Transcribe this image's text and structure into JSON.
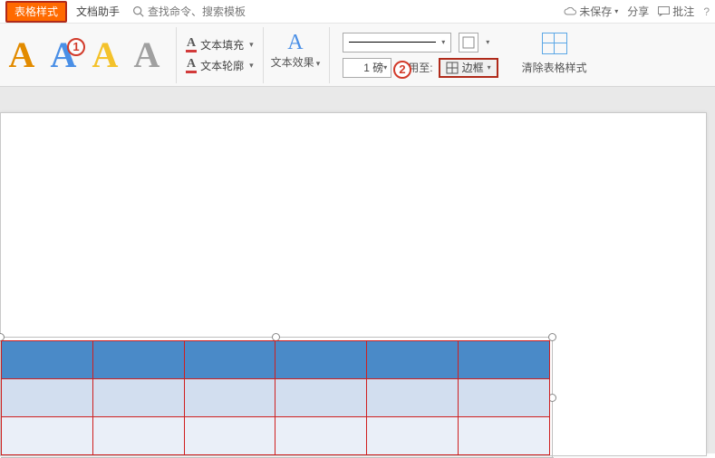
{
  "topbar": {
    "active_tab": "表格样式",
    "doc_helper": "文档助手",
    "search_placeholder": "查找命令、搜索模板",
    "unsaved": "未保存",
    "share": "分享",
    "annotate": "批注"
  },
  "ribbon": {
    "text_fill": "文本填充",
    "text_outline": "文本轮廓",
    "text_effect": "文本效果",
    "line_weight": "1 磅",
    "apply_to": "应用至:",
    "border_btn": "边框",
    "clear_style": "清除表格样式"
  },
  "annotations": {
    "one": "1",
    "two": "2"
  }
}
